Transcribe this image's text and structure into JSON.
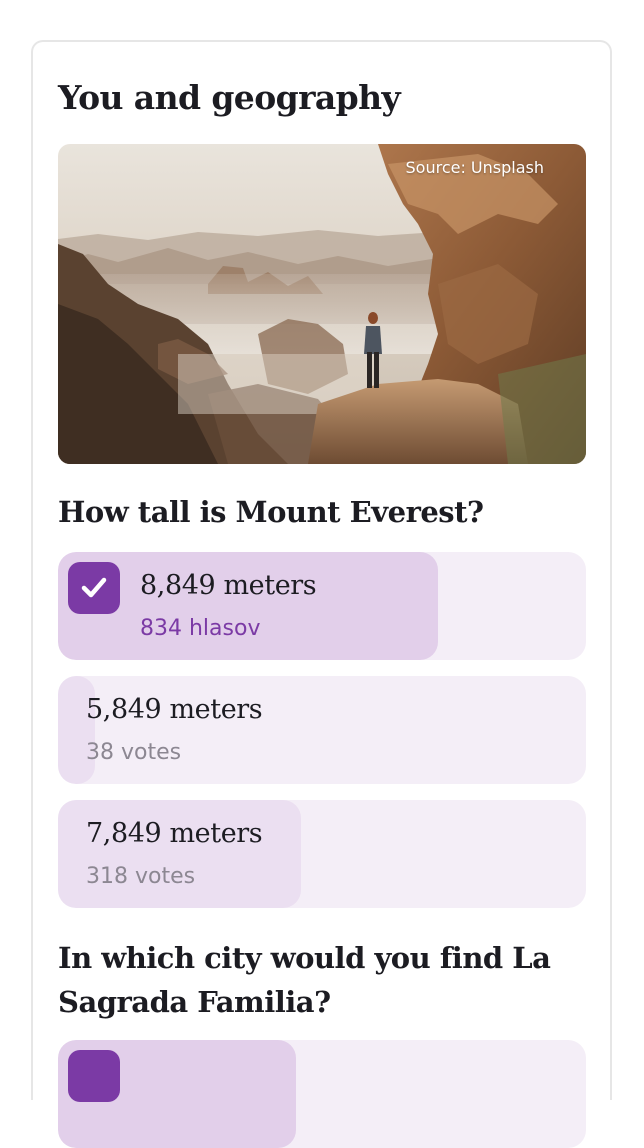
{
  "card": {
    "title": "You and geography",
    "image": {
      "source_label": "Source: Unsplash"
    }
  },
  "questions": [
    {
      "text": "How tall is Mount Everest?",
      "options": [
        {
          "label": "8,849 meters",
          "votes": "834 hlasov",
          "selected": true,
          "share": 0.72
        },
        {
          "label": "5,849 meters",
          "votes": "38 votes",
          "selected": false,
          "share": 0.07
        },
        {
          "label": "7,849 meters",
          "votes": "318 votes",
          "selected": false,
          "share": 0.46
        }
      ]
    },
    {
      "text": "In which city would you find La Sagrada Familia?",
      "options": [
        {
          "selected": true,
          "share": 0.45
        }
      ]
    }
  ],
  "colors": {
    "accent": "#7b3aa5",
    "option_bg": "#f4eef7",
    "selected_fill": "#e2cfea",
    "normal_fill": "#ebdff1"
  },
  "icons": {
    "check": "check-icon"
  }
}
